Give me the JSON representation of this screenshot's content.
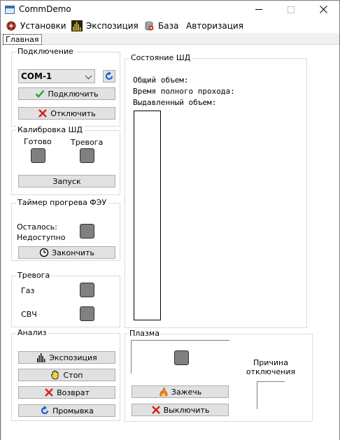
{
  "window": {
    "title": "CommDemo",
    "controls": {
      "minimize": "—",
      "maximize": "☐",
      "close": "✕"
    }
  },
  "menu": {
    "items": [
      {
        "label": "Установки",
        "icon": "gear-flower-icon"
      },
      {
        "label": "Экспозиция",
        "icon": "bar-chart-icon"
      },
      {
        "label": "База",
        "icon": "database-gear-icon"
      },
      {
        "label": "Авторизация",
        "icon": ""
      }
    ]
  },
  "tabs": {
    "active": "Главная"
  },
  "connection": {
    "title": "Подключение",
    "port_value": "COM-1",
    "connect_label": "Подключить",
    "disconnect_label": "Отключить"
  },
  "calibration": {
    "title": "Калибровка ШД",
    "ready_label": "Готово",
    "alarm_label": "Тревога",
    "start_label": "Запуск"
  },
  "timer": {
    "title": "Таймер прогрева ФЭУ",
    "remaining_label": "Осталось:",
    "status_label": "Недоступно",
    "finish_label": "Закончить"
  },
  "alarm": {
    "title": "Тревога",
    "gas_label": "Газ",
    "microwave_label": "СВЧ"
  },
  "analysis": {
    "title": "Анализ",
    "exposure_label": "Экспозиция",
    "stop_label": "Стоп",
    "return_label": "Возврат",
    "flush_label": "Промывка"
  },
  "sd_state": {
    "title": "Состояние ШД",
    "total_volume_label": "Общий объем:",
    "full_pass_time_label": "Время полного прохода:",
    "pushed_volume_label": "Выдавленный объем:"
  },
  "plasma": {
    "title": "Плазма",
    "ignite_label": "Зажечь",
    "off_label": "Выключить",
    "reason_label": "Причина отключения"
  },
  "colors": {
    "indicator": "#808080",
    "button_bg": "#e1e1e1",
    "border": "#dcdcdc"
  }
}
